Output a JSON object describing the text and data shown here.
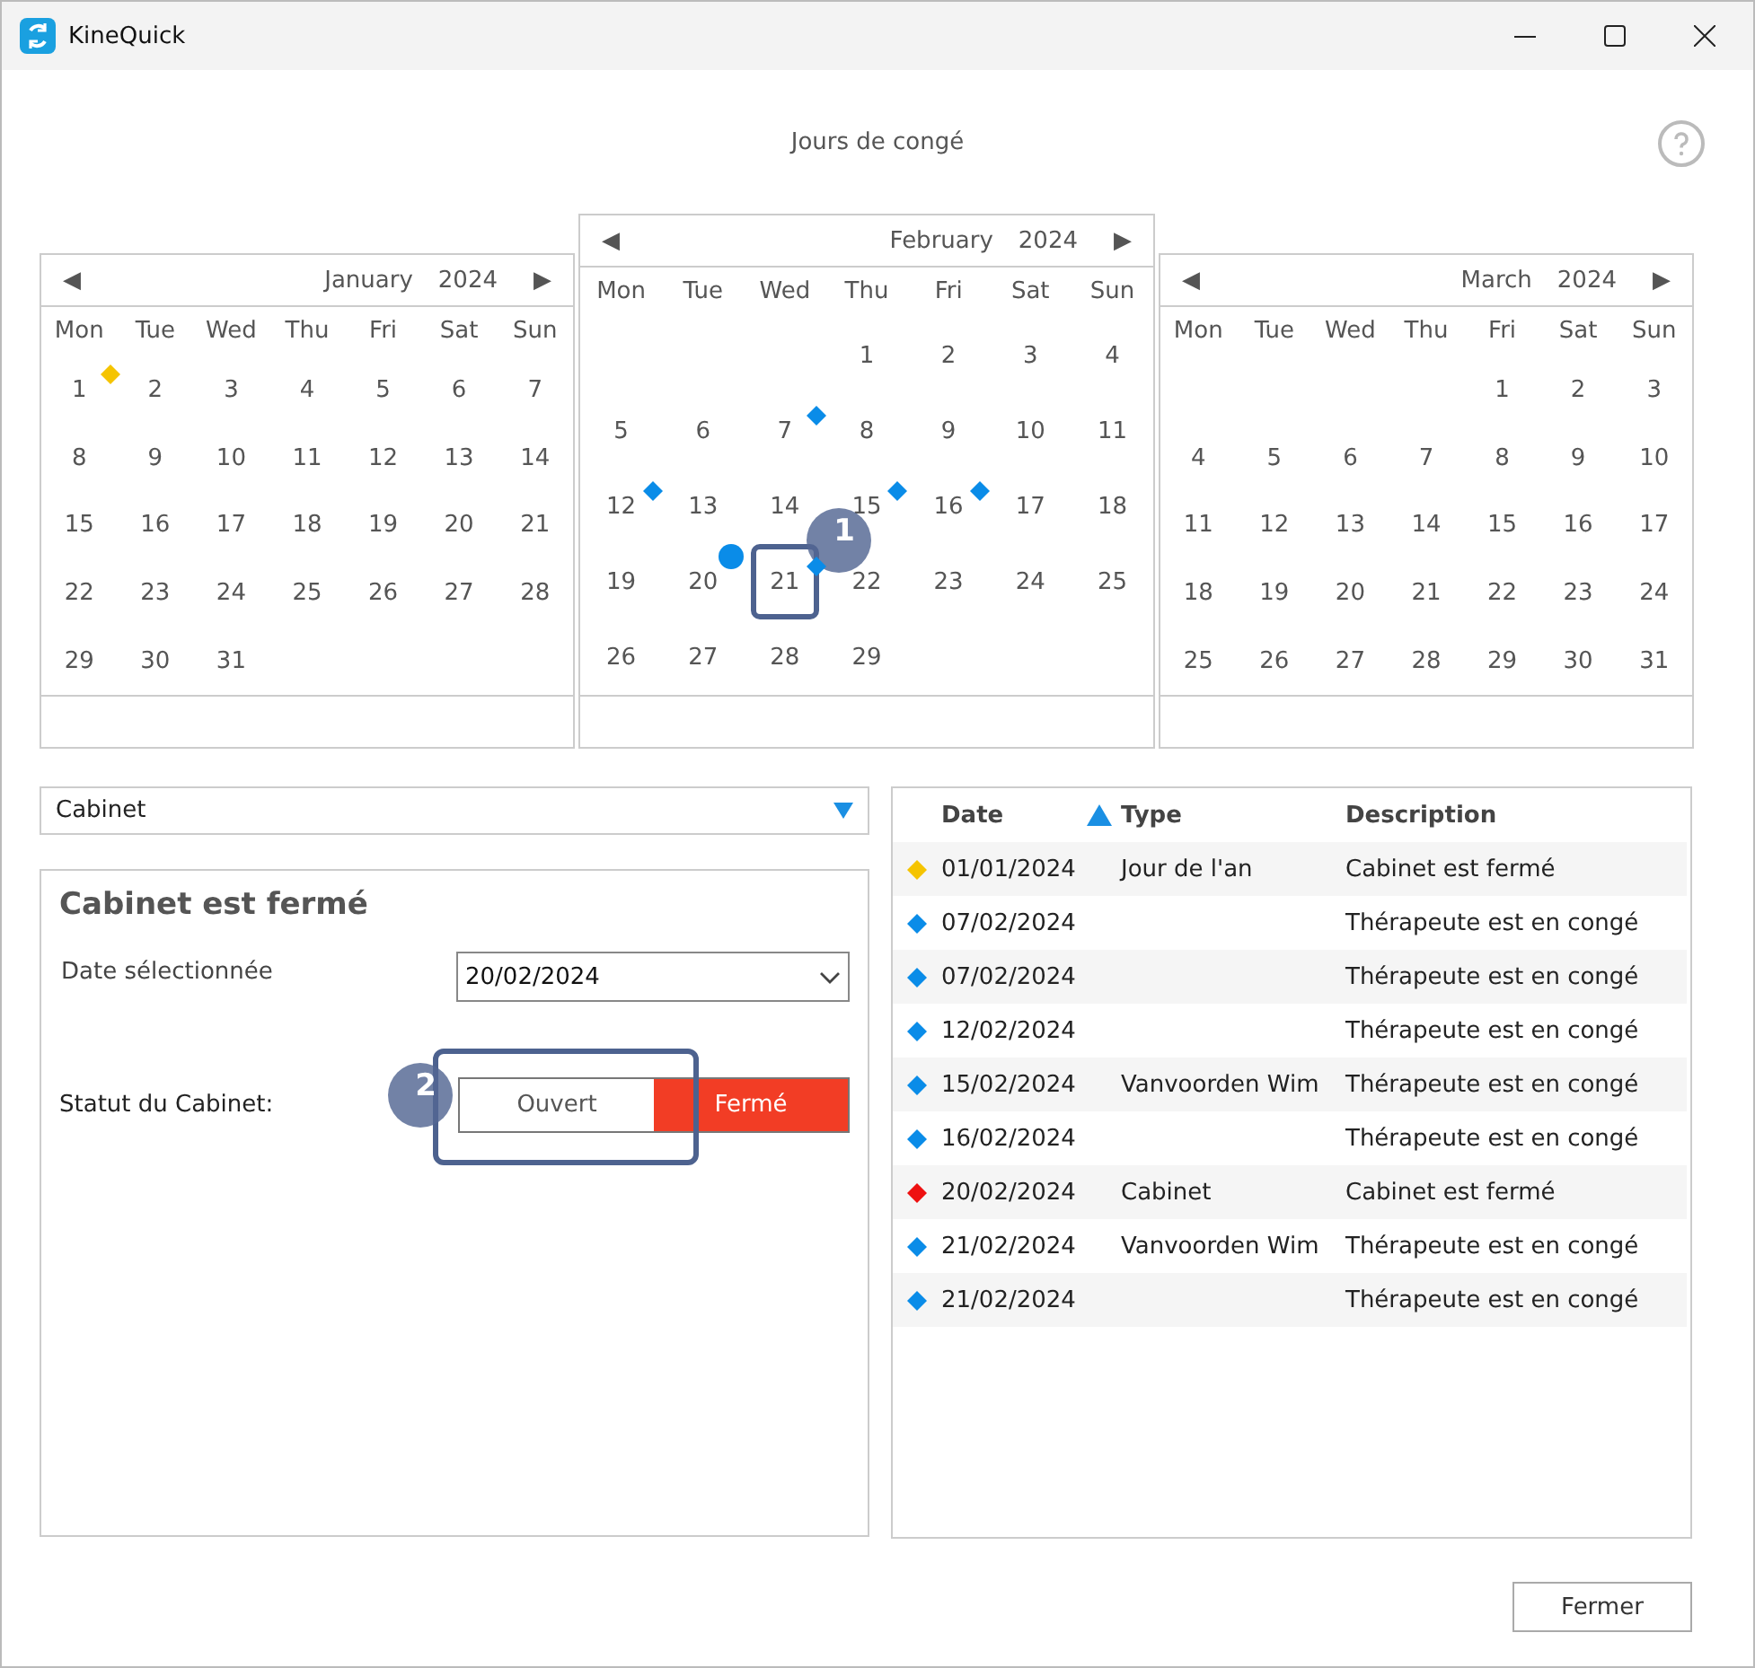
{
  "window": {
    "title": "KineQuick"
  },
  "dialog_title": "Jours de congé",
  "calendars": [
    {
      "prev": "◀",
      "month": "January",
      "year": "2024",
      "next": "▶",
      "raised": false,
      "weekdays": [
        "Mon",
        "Tue",
        "Wed",
        "Thu",
        "Fri",
        "Sat",
        "Sun"
      ],
      "weeks": [
        [
          {
            "day": "1",
            "kind": "diamond",
            "color": "#f5c400",
            "selected": false
          },
          "2",
          "3",
          "4",
          "5",
          "6",
          "7"
        ],
        [
          "8",
          "9",
          "10",
          "11",
          "12",
          "13",
          "14"
        ],
        [
          "15",
          "16",
          "17",
          "18",
          "19",
          "20",
          "21"
        ],
        [
          "22",
          "23",
          "24",
          "25",
          "26",
          "27",
          "28"
        ],
        [
          "29",
          "30",
          "31"
        ]
      ]
    },
    {
      "prev": "◀",
      "month": "February",
      "year": "2024",
      "next": "▶",
      "raised": true,
      "weekdays": [
        "Mon",
        "Tue",
        "Wed",
        "Thu",
        "Fri",
        "Sat",
        "Sun"
      ],
      "weeks": [
        [
          "1",
          "2",
          "3",
          "4"
        ],
        [
          "5",
          "6",
          {
            "day": "7",
            "kind": "diamond",
            "color": "#0a8ce8",
            "selected": false
          },
          "8",
          "9",
          "10",
          "11"
        ],
        [
          {
            "day": "12",
            "kind": "diamond",
            "color": "#0a8ce8",
            "selected": false
          },
          "13",
          "14",
          {
            "day": "15",
            "kind": "diamond",
            "color": "#0a8ce8",
            "selected": false
          },
          {
            "day": "16",
            "kind": "diamond",
            "color": "#0a8ce8",
            "selected": false
          },
          "17",
          "18"
        ],
        [
          "19",
          {
            "day": "20",
            "kind": "dot",
            "color": "#0a8ce8",
            "selected": false
          },
          {
            "day": "21",
            "kind": "diamond",
            "color": "#0a8ce8",
            "selected": true,
            "callout": "1"
          },
          "22",
          "23",
          "24",
          "25"
        ],
        [
          "26",
          "27",
          "28",
          "29"
        ]
      ]
    },
    {
      "prev": "◀",
      "month": "March",
      "year": "2024",
      "next": "▶",
      "raised": false,
      "weekdays": [
        "Mon",
        "Tue",
        "Wed",
        "Thu",
        "Fri",
        "Sat",
        "Sun"
      ],
      "weeks": [
        [
          "1",
          "2",
          "3"
        ],
        [
          "4",
          "5",
          "6",
          "7",
          "8",
          "9",
          "10"
        ],
        [
          "11",
          "12",
          "13",
          "14",
          "15",
          "16",
          "17"
        ],
        [
          "18",
          "19",
          "20",
          "21",
          "22",
          "23",
          "24"
        ],
        [
          "25",
          "26",
          "27",
          "28",
          "29",
          "30",
          "31"
        ]
      ]
    }
  ],
  "filter_dropdown": {
    "value": "Cabinet"
  },
  "detail": {
    "heading": "Cabinet est fermé",
    "date_label": "Date sélectionnée",
    "date_value": "20/02/2024",
    "status_label": "Statut du Cabinet:",
    "status_callout": "2",
    "status_options": [
      {
        "label": "Ouvert",
        "selected": false
      },
      {
        "label": "Fermé",
        "selected": true
      }
    ]
  },
  "table": {
    "columns": [
      {
        "label": "Date",
        "sorted": true
      },
      {
        "label": "Type"
      },
      {
        "label": "Description"
      }
    ],
    "rows": [
      {
        "color": "#f5c400",
        "date": "01/01/2024",
        "type": "Jour de l'an",
        "description": "Cabinet est fermé"
      },
      {
        "color": "#0a8ce8",
        "date": "07/02/2024",
        "description": "Thérapeute est en congé"
      },
      {
        "color": "#0a8ce8",
        "date": "07/02/2024",
        "description": "Thérapeute est en congé"
      },
      {
        "color": "#0a8ce8",
        "date": "12/02/2024",
        "description": "Thérapeute est en congé"
      },
      {
        "color": "#0a8ce8",
        "date": "15/02/2024",
        "type": "Vanvoorden Wim",
        "description": "Thérapeute est en congé"
      },
      {
        "color": "#0a8ce8",
        "date": "16/02/2024",
        "description": "Thérapeute est en congé"
      },
      {
        "color": "#ee1111",
        "date": "20/02/2024",
        "type": "Cabinet",
        "description": "Cabinet est fermé"
      },
      {
        "color": "#0a8ce8",
        "date": "21/02/2024",
        "type": "Vanvoorden Wim",
        "description": "Thérapeute est en congé"
      },
      {
        "color": "#0a8ce8",
        "date": "21/02/2024",
        "description": "Thérapeute est en congé"
      }
    ]
  },
  "close_button": "Fermer"
}
